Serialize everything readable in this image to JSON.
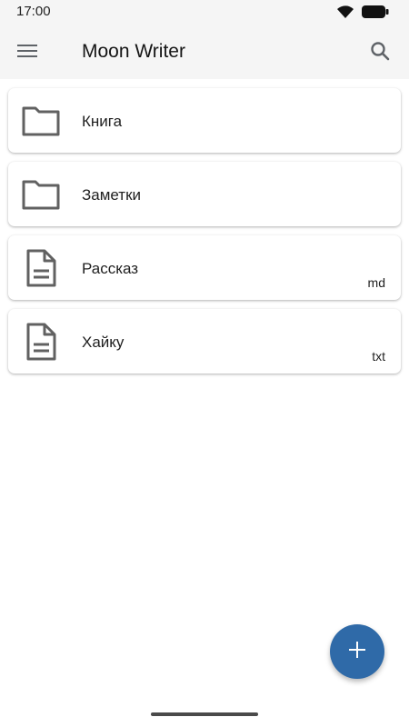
{
  "status_bar": {
    "time": "17:00",
    "icons": [
      "wifi-icon",
      "battery-icon"
    ]
  },
  "app_bar": {
    "title": "Moon Writer",
    "menu_icon": "menu-icon",
    "search_icon": "search-icon"
  },
  "files": [
    {
      "name": "Книга",
      "type": "folder",
      "icon": "folder-icon",
      "ext": ""
    },
    {
      "name": "Заметки",
      "type": "folder",
      "icon": "folder-icon",
      "ext": ""
    },
    {
      "name": "Рассказ",
      "type": "file",
      "icon": "document-icon",
      "ext": "md"
    },
    {
      "name": "Хайку",
      "type": "file",
      "icon": "document-icon",
      "ext": "txt"
    }
  ],
  "fab": {
    "icon": "add-icon"
  },
  "colors": {
    "accent": "#2f6aa8",
    "bar_background": "#f5f5f5",
    "icon_gray": "#616161"
  }
}
